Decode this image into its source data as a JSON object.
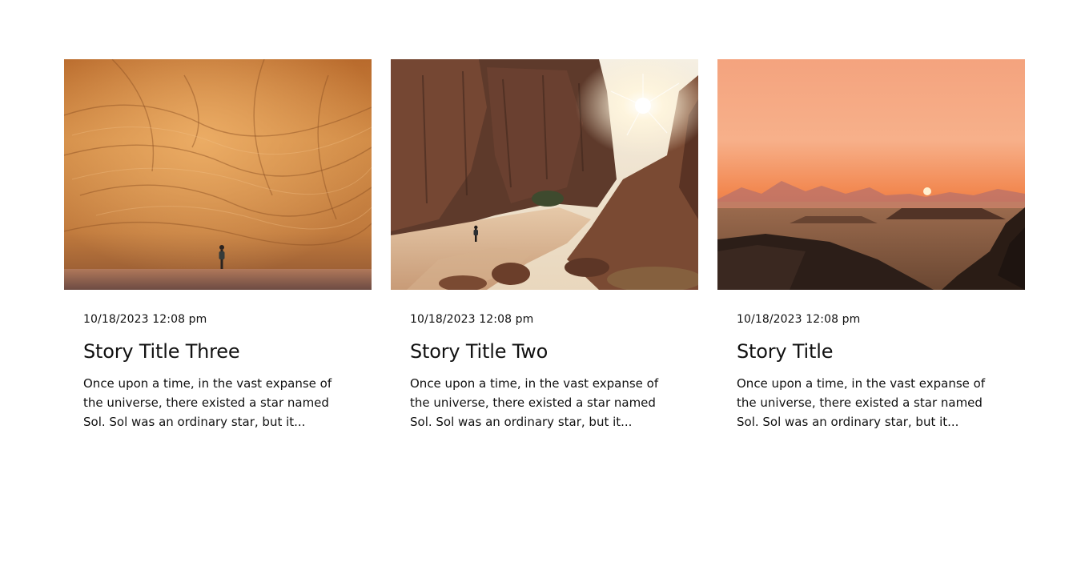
{
  "stories": [
    {
      "image_alt": "Hiker standing beneath a towering orange sandstone rock face",
      "date": "10/18/2023 12:08 pm",
      "title": "Story Title Three",
      "excerpt": "Once upon a time, in the vast expanse of the universe, there existed a star named Sol. Sol was an ordinary star, but it..."
    },
    {
      "image_alt": "Lone walker in a desert canyon with the sun bursting over cliffs",
      "date": "10/18/2023 12:08 pm",
      "title": "Story Title Two",
      "excerpt": "Once upon a time, in the vast expanse of the universe, there existed a star named Sol. Sol was an ordinary star, but it..."
    },
    {
      "image_alt": "Sunset over a hazy desert landscape with rock formations",
      "date": "10/18/2023 12:08 pm",
      "title": "Story Title",
      "excerpt": "Once upon a time, in the vast expanse of the universe, there existed a star named Sol. Sol was an ordinary star, but it..."
    }
  ]
}
